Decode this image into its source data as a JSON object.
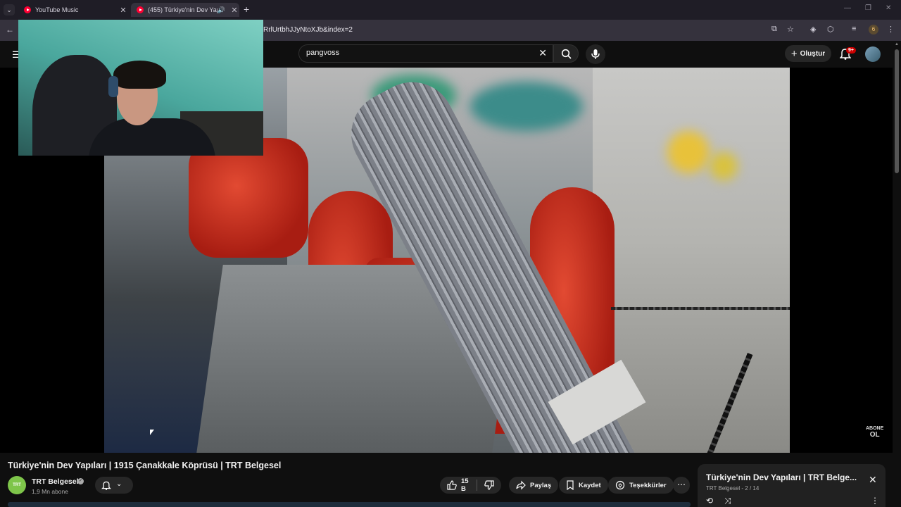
{
  "browser": {
    "tabs": [
      {
        "title": "YouTube Music",
        "active": false
      },
      {
        "title": "(455) Türkiye'nin Dev Yapıla",
        "active": true
      }
    ],
    "url": "RrlUrtbhJJyNtoXJb&index=2",
    "profile_badge": "6"
  },
  "masthead": {
    "search_value": "pangvoss",
    "create_label": "Oluştur",
    "notifications": "9+"
  },
  "video": {
    "overlay_abone_top": "ABONE",
    "overlay_abone_bottom": "OL"
  },
  "info": {
    "title": "Türkiye'nin Dev Yapıları | 1915 Çanakkale Köprüsü | TRT Belgesel",
    "channel_name": "TRT Belgesel",
    "channel_avatar_text": "TRT",
    "subscribers": "1,9 Mn abone",
    "likes": "15 B",
    "share_label": "Paylaş",
    "save_label": "Kaydet",
    "thanks_label": "Teşekkürler"
  },
  "playlist": {
    "title": "Türkiye'nin Dev Yapıları | TRT Belge...",
    "channel": "TRT Belgesel",
    "position": "2 / 14"
  },
  "colors": {
    "accent_red": "#ff0033",
    "background": "#0f0f0f",
    "pill": "#272727"
  }
}
